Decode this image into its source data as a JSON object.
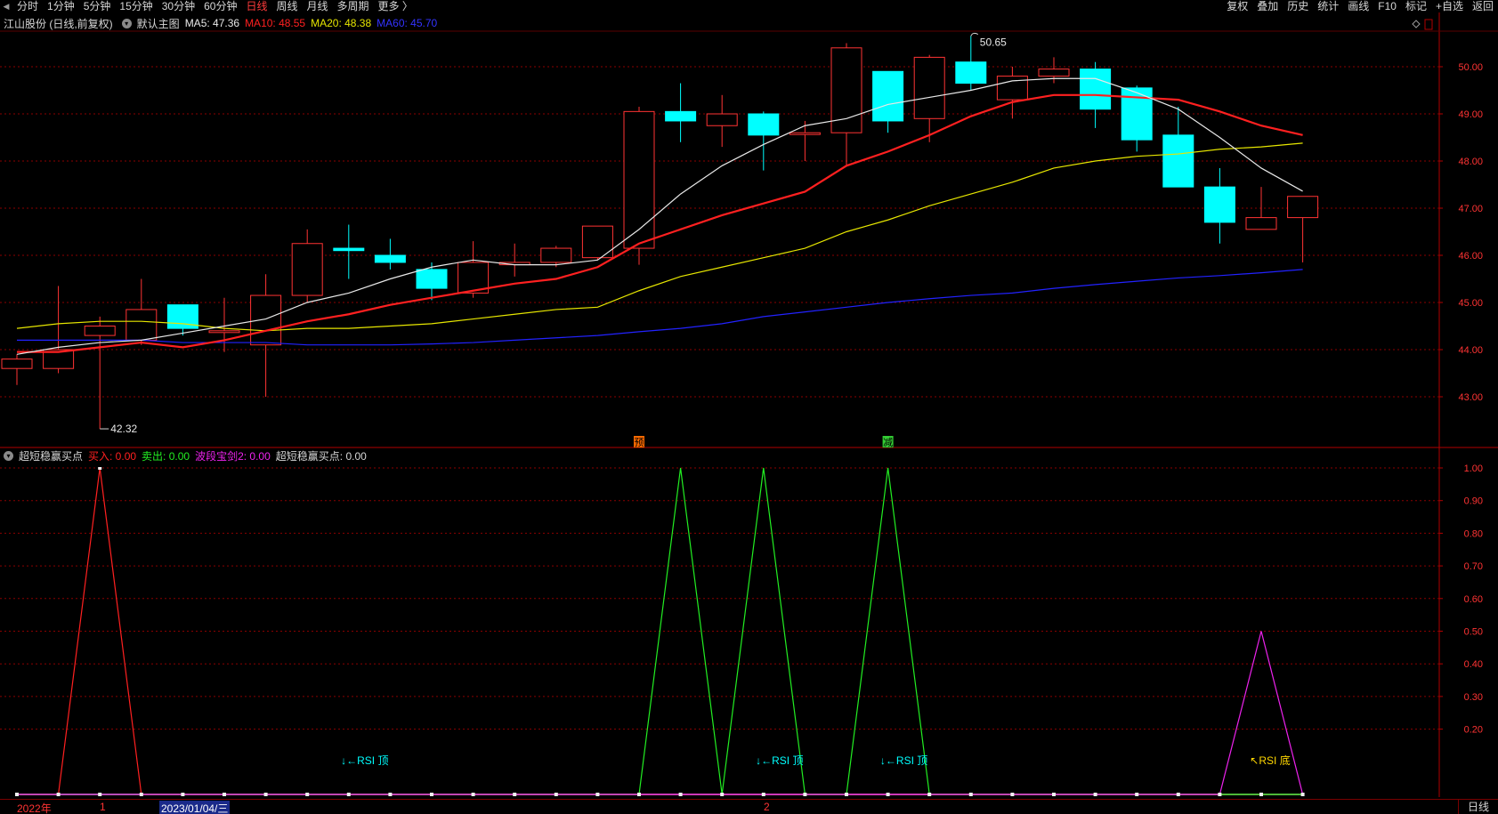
{
  "toolbar": {
    "timeframes": [
      "分时",
      "1分钟",
      "5分钟",
      "15分钟",
      "30分钟",
      "60分钟",
      "日线",
      "周线",
      "月线",
      "多周期",
      "更多 〉"
    ],
    "active_index": 6,
    "tools": [
      "复权",
      "叠加",
      "历史",
      "统计",
      "画线",
      "F10",
      "标记",
      "+自选",
      "返回"
    ]
  },
  "main_panel": {
    "stock": "江山股份 (日线,前复权)",
    "template": "默认主图",
    "ma5_label": "MA5: 47.36",
    "ma10_label": "MA10: 48.55",
    "ma20_label": "MA20: 48.38",
    "ma60_label": "MA60: 45.70",
    "price_ticks": [
      "50.00",
      "49.00",
      "48.00",
      "47.00",
      "46.00",
      "45.00",
      "44.00",
      "43.00"
    ],
    "high_marker": "50.65",
    "low_marker": "42.32",
    "signal_pre": "预",
    "signal_reduce": "减"
  },
  "indicator_panel": {
    "name": "超短稳赢买点",
    "buy_label": "买入: 0.00",
    "sell_label": "卖出: 0.00",
    "band_label": "波段宝剑2: 0.00",
    "point_label": "超短稳赢买点: 0.00",
    "ticks": [
      "1.00",
      "0.90",
      "0.80",
      "0.70",
      "0.60",
      "0.50",
      "0.40",
      "0.30",
      "0.20"
    ],
    "rsi_top": "↓←RSI 顶",
    "rsi_bottom": "↖RSI 底"
  },
  "bottom_bar": {
    "year_label": "2022年",
    "month_1": "1",
    "cursor_date": "2023/01/04/三",
    "month_2": "2",
    "period_button": "日线"
  },
  "colors": {
    "up": "#ff3333",
    "down": "#00ffff",
    "ma5": "#e8e8e8",
    "ma10": "#ff2020",
    "ma20": "#e6e600",
    "ma60": "#2222ff",
    "buy": "#ff2020",
    "sell": "#22ee22",
    "band": "#ee22ee",
    "grid": "#8b0000"
  },
  "chart_data": {
    "type": "candlestick",
    "price_axis": [
      42.32,
      50.65
    ],
    "candles": [
      {
        "o": 43.6,
        "h": 43.9,
        "l": 43.25,
        "c": 43.8
      },
      {
        "o": 43.6,
        "h": 45.35,
        "l": 43.5,
        "c": 44.0
      },
      {
        "o": 44.3,
        "h": 44.7,
        "l": 42.32,
        "c": 44.5
      },
      {
        "o": 44.2,
        "h": 45.5,
        "l": 44.1,
        "c": 44.85
      },
      {
        "o": 44.95,
        "h": 44.95,
        "l": 44.3,
        "c": 44.45
      },
      {
        "o": 44.4,
        "h": 45.1,
        "l": 43.95,
        "c": 44.4
      },
      {
        "o": 44.1,
        "h": 45.6,
        "l": 43.0,
        "c": 45.15
      },
      {
        "o": 45.15,
        "h": 46.55,
        "l": 45.0,
        "c": 46.25
      },
      {
        "o": 46.15,
        "h": 46.65,
        "l": 45.5,
        "c": 46.1
      },
      {
        "o": 46.0,
        "h": 46.35,
        "l": 45.7,
        "c": 45.85
      },
      {
        "o": 45.7,
        "h": 45.85,
        "l": 45.05,
        "c": 45.3
      },
      {
        "o": 45.2,
        "h": 46.3,
        "l": 45.1,
        "c": 45.85
      },
      {
        "o": 45.8,
        "h": 46.25,
        "l": 45.55,
        "c": 45.85
      },
      {
        "o": 45.85,
        "h": 46.2,
        "l": 45.75,
        "c": 46.15
      },
      {
        "o": 45.95,
        "h": 46.62,
        "l": 45.9,
        "c": 46.62
      },
      {
        "o": 46.15,
        "h": 49.15,
        "l": 45.8,
        "c": 49.05
      },
      {
        "o": 49.05,
        "h": 49.65,
        "l": 48.4,
        "c": 48.85
      },
      {
        "o": 48.75,
        "h": 49.4,
        "l": 48.3,
        "c": 49.0
      },
      {
        "o": 49.0,
        "h": 49.05,
        "l": 47.8,
        "c": 48.55
      },
      {
        "o": 48.6,
        "h": 48.85,
        "l": 48.0,
        "c": 48.6
      },
      {
        "o": 48.6,
        "h": 50.5,
        "l": 47.9,
        "c": 50.4
      },
      {
        "o": 49.9,
        "h": 49.9,
        "l": 48.6,
        "c": 48.85
      },
      {
        "o": 48.9,
        "h": 50.25,
        "l": 48.4,
        "c": 50.2
      },
      {
        "o": 50.1,
        "h": 50.65,
        "l": 49.5,
        "c": 49.65
      },
      {
        "o": 49.3,
        "h": 50.0,
        "l": 48.9,
        "c": 49.8
      },
      {
        "o": 49.8,
        "h": 50.2,
        "l": 49.65,
        "c": 49.95
      },
      {
        "o": 49.95,
        "h": 50.1,
        "l": 48.7,
        "c": 49.1
      },
      {
        "o": 49.55,
        "h": 49.6,
        "l": 48.2,
        "c": 48.45
      },
      {
        "o": 48.55,
        "h": 49.15,
        "l": 47.45,
        "c": 47.45
      },
      {
        "o": 47.45,
        "h": 47.85,
        "l": 46.25,
        "c": 46.7
      },
      {
        "o": 46.55,
        "h": 47.45,
        "l": 46.55,
        "c": 46.8
      },
      {
        "o": 46.8,
        "h": 47.25,
        "l": 45.85,
        "c": 47.25
      }
    ],
    "ma5": [
      43.9,
      44.05,
      44.15,
      44.2,
      44.35,
      44.5,
      44.65,
      45.0,
      45.2,
      45.5,
      45.75,
      45.9,
      45.8,
      45.8,
      45.9,
      46.55,
      47.3,
      47.9,
      48.35,
      48.75,
      48.9,
      49.2,
      49.35,
      49.5,
      49.7,
      49.75,
      49.75,
      49.45,
      49.1,
      48.5,
      47.85,
      47.36
    ],
    "ma10": [
      43.95,
      43.95,
      44.05,
      44.15,
      44.05,
      44.2,
      44.4,
      44.6,
      44.75,
      44.95,
      45.1,
      45.25,
      45.4,
      45.5,
      45.75,
      46.25,
      46.55,
      46.85,
      47.1,
      47.35,
      47.9,
      48.2,
      48.55,
      48.95,
      49.25,
      49.4,
      49.4,
      49.35,
      49.3,
      49.05,
      48.75,
      48.55
    ],
    "ma20": [
      44.45,
      44.55,
      44.6,
      44.6,
      44.55,
      44.45,
      44.4,
      44.45,
      44.45,
      44.5,
      44.55,
      44.65,
      44.75,
      44.85,
      44.9,
      45.25,
      45.55,
      45.75,
      45.95,
      46.15,
      46.5,
      46.75,
      47.05,
      47.3,
      47.55,
      47.85,
      48.0,
      48.1,
      48.15,
      48.25,
      48.3,
      48.38
    ],
    "ma60": [
      44.2,
      44.2,
      44.2,
      44.2,
      44.15,
      44.15,
      44.15,
      44.1,
      44.1,
      44.1,
      44.12,
      44.15,
      44.2,
      44.25,
      44.3,
      44.38,
      44.45,
      44.55,
      44.7,
      44.8,
      44.9,
      45.0,
      45.08,
      45.15,
      45.2,
      45.3,
      45.38,
      45.45,
      45.52,
      45.57,
      45.63,
      45.7
    ],
    "buy": [
      0,
      0,
      1,
      0,
      0,
      0,
      0,
      0,
      0,
      0,
      0,
      0,
      0,
      0,
      0,
      0,
      0,
      0,
      0,
      0,
      0,
      0,
      0,
      0,
      0,
      0,
      0,
      0,
      0,
      0,
      0,
      0
    ],
    "sell": [
      0,
      0,
      0,
      0,
      0,
      0,
      0,
      0,
      0,
      0,
      0,
      0,
      0,
      0,
      0,
      0,
      1,
      0,
      1,
      0,
      0,
      1,
      0,
      0,
      0,
      0,
      0,
      0,
      0,
      0,
      0,
      0
    ],
    "band": [
      0,
      0,
      0,
      0,
      0,
      0,
      0,
      0,
      0,
      0,
      0,
      0,
      0,
      0,
      0,
      0,
      0,
      0,
      0,
      0,
      0,
      0,
      0,
      0,
      0,
      0,
      0,
      0,
      0,
      0,
      0.5,
      0
    ],
    "rsi_top_at": [
      8,
      18,
      21
    ],
    "rsi_bottom_at": [
      30
    ]
  }
}
